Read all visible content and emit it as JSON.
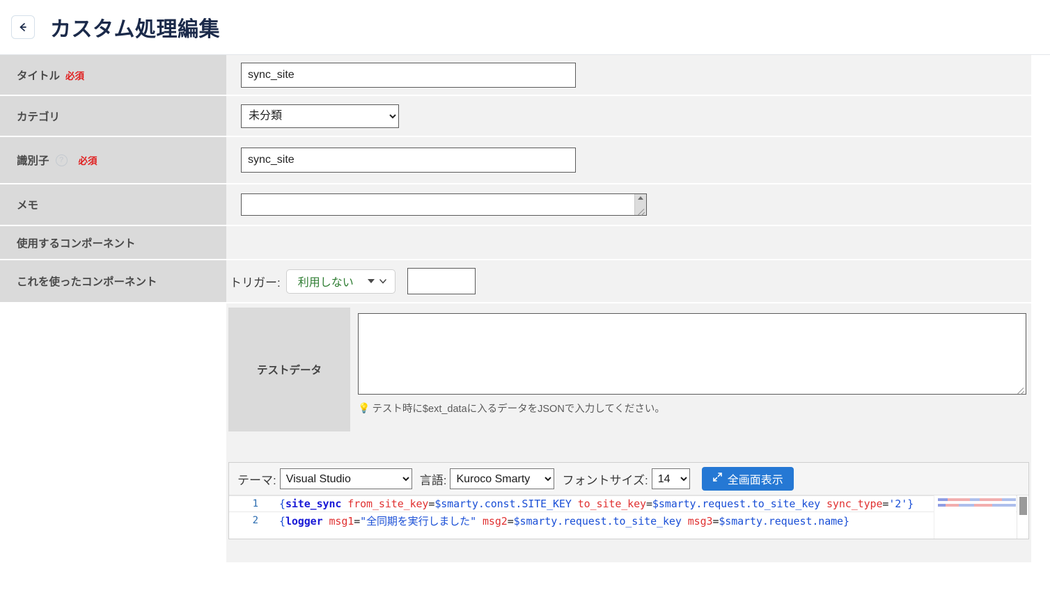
{
  "header": {
    "back_icon": "arrow-left-icon",
    "title": "カスタム処理編集"
  },
  "form": {
    "rows": [
      {
        "label": "タイトル",
        "required": "必須"
      },
      {
        "label": "カテゴリ",
        "required": ""
      },
      {
        "label": "識別子",
        "required": "必須",
        "help_icon": "question-mark-icon"
      },
      {
        "label": "メモ",
        "required": ""
      },
      {
        "label": "使用するコンポーネント",
        "required": ""
      },
      {
        "label": "これを使ったコンポーネント",
        "required": ""
      }
    ],
    "title_value": "sync_site",
    "title_placeholder": "",
    "category_value": "未分類",
    "category_options": [
      "未分類"
    ],
    "identifier_value": "sync_site",
    "identifier_placeholder": "",
    "memo_value": "",
    "memo_placeholder": ""
  },
  "trigger": {
    "label": "トリガー:",
    "value": "利用しない",
    "options": [
      "利用しない"
    ],
    "input_value": "",
    "caret_icon": "chevron-down-icon"
  },
  "test_data": {
    "label": "テストデータ",
    "value": "",
    "placeholder": "",
    "hint_icon": "lightbulb-icon",
    "hint": "テスト時に$ext_dataに入るデータをJSONで入力してください。"
  },
  "editor": {
    "theme_label": "テーマ:",
    "theme_value": "Visual Studio",
    "theme_options": [
      "Visual Studio"
    ],
    "lang_label": "言語:",
    "lang_value": "Kuroco Smarty",
    "lang_options": [
      "Kuroco Smarty"
    ],
    "fontsize_label": "フォントサイズ:",
    "fontsize_value": "14",
    "fontsize_options": [
      "14"
    ],
    "fullscreen_label": "全画面表示",
    "fullscreen_icon": "expand-arrows-icon",
    "lines": [
      {
        "number": "1",
        "tokens": [
          {
            "t": "{",
            "c": "br"
          },
          {
            "t": "site_sync",
            "c": "tag"
          },
          {
            "t": " ",
            "c": "plain"
          },
          {
            "t": "from_site_key",
            "c": "attr"
          },
          {
            "t": "=",
            "c": "plain"
          },
          {
            "t": "$smarty.const.SITE_KEY",
            "c": "var"
          },
          {
            "t": " ",
            "c": "plain"
          },
          {
            "t": "to_site_key",
            "c": "attr"
          },
          {
            "t": "=",
            "c": "plain"
          },
          {
            "t": "$smarty.request.to_site_key",
            "c": "var"
          },
          {
            "t": "  ",
            "c": "plain"
          },
          {
            "t": "sync_type",
            "c": "attr"
          },
          {
            "t": "=",
            "c": "plain"
          },
          {
            "t": "'2'",
            "c": "str"
          },
          {
            "t": "}",
            "c": "br"
          }
        ]
      },
      {
        "number": "2",
        "tokens": [
          {
            "t": "{",
            "c": "br"
          },
          {
            "t": "logger",
            "c": "tag"
          },
          {
            "t": " ",
            "c": "plain"
          },
          {
            "t": "msg1",
            "c": "attr"
          },
          {
            "t": "=",
            "c": "plain"
          },
          {
            "t": "\"全同期を実行しました\"",
            "c": "str"
          },
          {
            "t": " ",
            "c": "plain"
          },
          {
            "t": "msg2",
            "c": "attr"
          },
          {
            "t": "=",
            "c": "plain"
          },
          {
            "t": "$smarty.request.to_site_key",
            "c": "var"
          },
          {
            "t": " ",
            "c": "plain"
          },
          {
            "t": "msg3",
            "c": "attr"
          },
          {
            "t": "=",
            "c": "plain"
          },
          {
            "t": "$smarty.request.name",
            "c": "var"
          },
          {
            "t": "}",
            "c": "br"
          }
        ]
      }
    ]
  },
  "colors": {
    "accent": "#2578d4",
    "required": "#e02020",
    "label_bg": "#dadada",
    "value_bg": "#f2f2f2",
    "trigger_text": "#2e7d32",
    "hint": "#5a5a5a"
  }
}
